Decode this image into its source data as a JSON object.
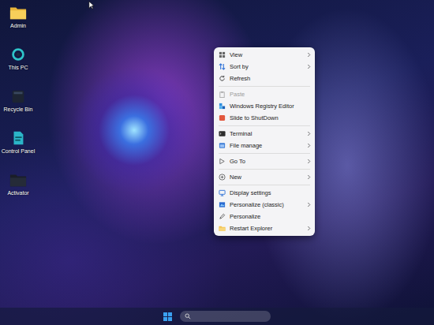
{
  "desktop_icons": [
    {
      "label": "Admin"
    },
    {
      "label": "This PC"
    },
    {
      "label": "Recycle Bin"
    },
    {
      "label": "Control Panel"
    },
    {
      "label": "Activator"
    }
  ],
  "context_menu": {
    "groups": [
      {
        "items": [
          {
            "label": "View",
            "submenu": true,
            "disabled": false
          },
          {
            "label": "Sort by",
            "submenu": true,
            "disabled": false
          },
          {
            "label": "Refresh",
            "submenu": false,
            "disabled": false
          }
        ]
      },
      {
        "items": [
          {
            "label": "Paste",
            "submenu": false,
            "disabled": true
          },
          {
            "label": "Windows Registry Editor",
            "submenu": false,
            "disabled": false
          },
          {
            "label": "Slide to ShutDown",
            "submenu": false,
            "disabled": false
          }
        ]
      },
      {
        "items": [
          {
            "label": "Terminal",
            "submenu": true,
            "disabled": false
          },
          {
            "label": "File manage",
            "submenu": true,
            "disabled": false
          }
        ]
      },
      {
        "items": [
          {
            "label": "Go To",
            "submenu": true,
            "disabled": false
          }
        ]
      },
      {
        "items": [
          {
            "label": "New",
            "submenu": true,
            "disabled": false
          }
        ]
      },
      {
        "items": [
          {
            "label": "Display settings",
            "submenu": false,
            "disabled": false
          },
          {
            "label": "Personalize (classic)",
            "submenu": true,
            "disabled": false
          },
          {
            "label": "Personalize",
            "submenu": false,
            "disabled": false
          },
          {
            "label": "Restart Explorer",
            "submenu": true,
            "disabled": false
          }
        ]
      }
    ]
  }
}
